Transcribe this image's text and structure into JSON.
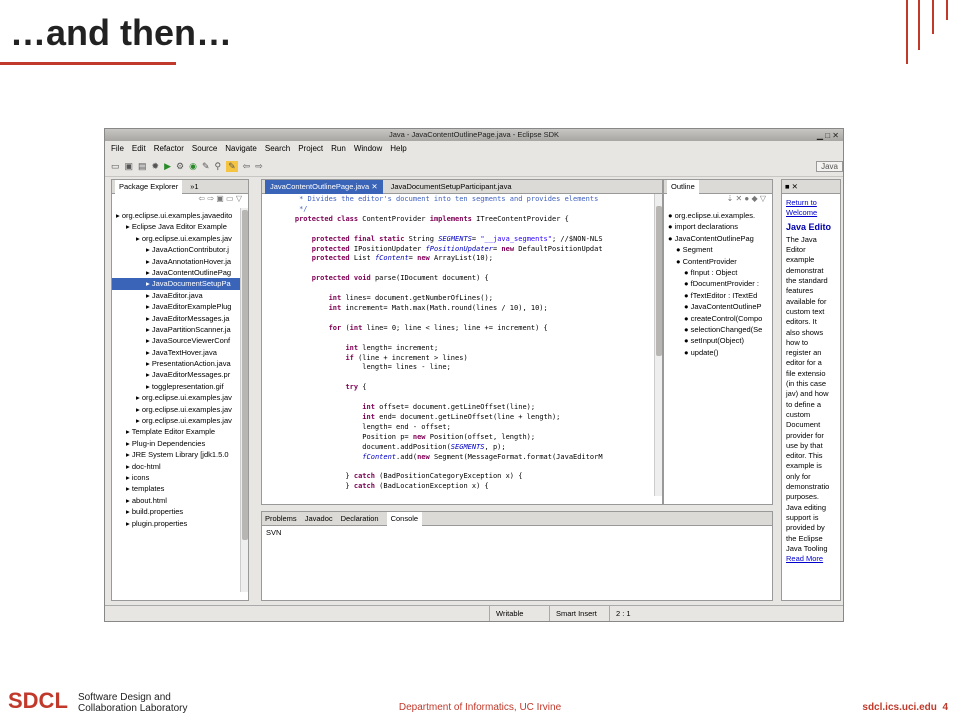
{
  "slide": {
    "title": "…and then…",
    "page_number": "4"
  },
  "window": {
    "title": "Java - JavaContentOutlinePage.java - Eclipse SDK",
    "controls": "▁ □ ✕"
  },
  "menu": [
    "File",
    "Edit",
    "Refactor",
    "Source",
    "Navigate",
    "Search",
    "Project",
    "Run",
    "Window",
    "Help"
  ],
  "toolbar": {
    "perspective": "Java"
  },
  "package_explorer": {
    "tab": "Package Explorer",
    "tab2": "»1",
    "items": [
      "org.eclipse.ui.examples.javaedito",
      "Eclipse Java Editor Example",
      "org.eclipse.ui.examples.jav",
      "JavaActionContributor.j",
      "JavaAnnotationHover.ja",
      "JavaContentOutlinePag",
      "JavaDocumentSetupPa",
      "JavaEditor.java",
      "JavaEditorExamplePlug",
      "JavaEditorMessages.ja",
      "JavaPartitionScanner.ja",
      "JavaSourceViewerConf",
      "JavaTextHover.java",
      "PresentationAction.java",
      "JavaEditorMessages.pr",
      "togglepresentation.gif",
      "org.eclipse.ui.examples.jav",
      "org.eclipse.ui.examples.jav",
      "org.eclipse.ui.examples.jav",
      "Template Editor Example",
      "Plug-in Dependencies",
      "JRE System Library [jdk1.5.0",
      "doc-html",
      "icons",
      "templates",
      "about.html",
      "build.properties",
      "plugin.properties"
    ]
  },
  "editor": {
    "tab1": "JavaContentOutlinePage.java",
    "tab2": "JavaDocumentSetupParticipant.java",
    "lines": [
      "     * Divides the editor's document into ten segments and provides elements",
      "     */",
      "    protected class ContentProvider implements ITreeContentProvider {",
      "",
      "        protected final static String SEGMENTS= \"__java_segments\"; //$NON-NLS",
      "        protected IPositionUpdater fPositionUpdater= new DefaultPositionUpdat",
      "        protected List fContent= new ArrayList(10);",
      "",
      "        protected void parse(IDocument document) {",
      "",
      "            int lines= document.getNumberOfLines();",
      "            int increment= Math.max(Math.round(lines / 10), 10);",
      "",
      "            for (int line= 0; line < lines; line += increment) {",
      "",
      "                int length= increment;",
      "                if (line + increment > lines)",
      "                    length= lines - line;",
      "",
      "                try {",
      "",
      "                    int offset= document.getLineOffset(line);",
      "                    int end= document.getLineOffset(line + length);",
      "                    length= end - offset;",
      "                    Position p= new Position(offset, length);",
      "                    document.addPosition(SEGMENTS, p);",
      "                    fContent.add(new Segment(MessageFormat.format(JavaEditorM",
      "",
      "                } catch (BadPositionCategoryException x) {",
      "                } catch (BadLocationException x) {"
    ]
  },
  "outline": {
    "tab": "Outline",
    "items": [
      "org.eclipse.ui.examples.",
      "import declarations",
      "JavaContentOutlinePag",
      "Segment",
      "ContentProvider",
      "fInput : Object",
      "fDocumentProvider :",
      "fTextEditor : ITextEd",
      "JavaContentOutlineP",
      "createControl(Compo",
      "selectionChanged(Se",
      "setInput(Object)",
      "update()"
    ]
  },
  "help": {
    "link": "Return to Welcome",
    "heading": "Java Edito",
    "lines": [
      "The Java",
      "Editor",
      "example",
      "demonstrat",
      "the standard",
      "features",
      "available for",
      "custom text",
      "editors. It",
      "also shows",
      "how to",
      "register an",
      "editor for a",
      "file extensio",
      "(in this case",
      "jav) and how",
      "to define a",
      "custom",
      "Document",
      "provider for",
      "use by that",
      "editor. This",
      "example is",
      "only for",
      "demonstratio",
      "purposes.",
      "Java editing",
      "support is",
      "provided by",
      "the Eclipse",
      "Java Tooling"
    ],
    "more": "Read More"
  },
  "bottom": {
    "tabs": [
      "Problems",
      "Javadoc",
      "Declaration",
      "Console"
    ],
    "console_text": "SVN"
  },
  "status": {
    "mode": "Writable",
    "insert": "Smart Insert",
    "pos": "2 : 1"
  },
  "footer": {
    "logo": "SDCL",
    "lab_line1": "Software Design and",
    "lab_line2": "Collaboration  Laboratory",
    "dept": "Department of Informatics, UC Irvine",
    "site": "sdcl.ics.uci.edu"
  },
  "colors": {
    "accent": "#c0392b",
    "selection": "#3a64b8"
  }
}
